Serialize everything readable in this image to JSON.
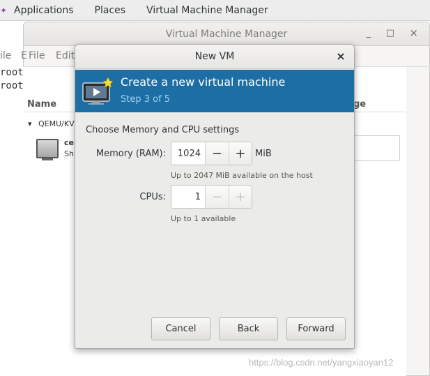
{
  "top_bar": {
    "applications": "Applications",
    "places": "Places",
    "vmm": "Virtual Machine Manager"
  },
  "terminal": {
    "line1": "root@",
    "line2": "root@"
  },
  "background_window": {
    "title": "Virtual Machine Manager",
    "minimize": "_",
    "maximize": "□",
    "close": "×",
    "menu_file_left": "ile",
    "menu_e": "E",
    "menu_file": "File",
    "menu_edit": "Edit",
    "col_name": "Name",
    "col_usage": "ge",
    "group": "QEMU/KV",
    "vm_name": "cer",
    "vm_status": "Shu"
  },
  "dialog": {
    "title": "New VM",
    "close": "×",
    "banner_title": "Create a new virtual machine",
    "banner_step": "Step 3 of 5",
    "section_title": "Choose Memory and CPU settings",
    "memory": {
      "label": "Memory (RAM):",
      "value": "1024",
      "minus": "−",
      "plus": "+",
      "unit": "MiB",
      "hint": "Up to 2047 MiB available on the host"
    },
    "cpus": {
      "label": "CPUs:",
      "value": "1",
      "minus": "−",
      "plus": "+",
      "hint": "Up to 1 available"
    },
    "buttons": {
      "cancel": "Cancel",
      "back": "Back",
      "forward": "Forward"
    }
  },
  "watermark": "https://blog.csdn.net/yangxiaoyan12",
  "colors": {
    "banner": "#1e6ea6",
    "banner_step": "#9fd0f0"
  }
}
